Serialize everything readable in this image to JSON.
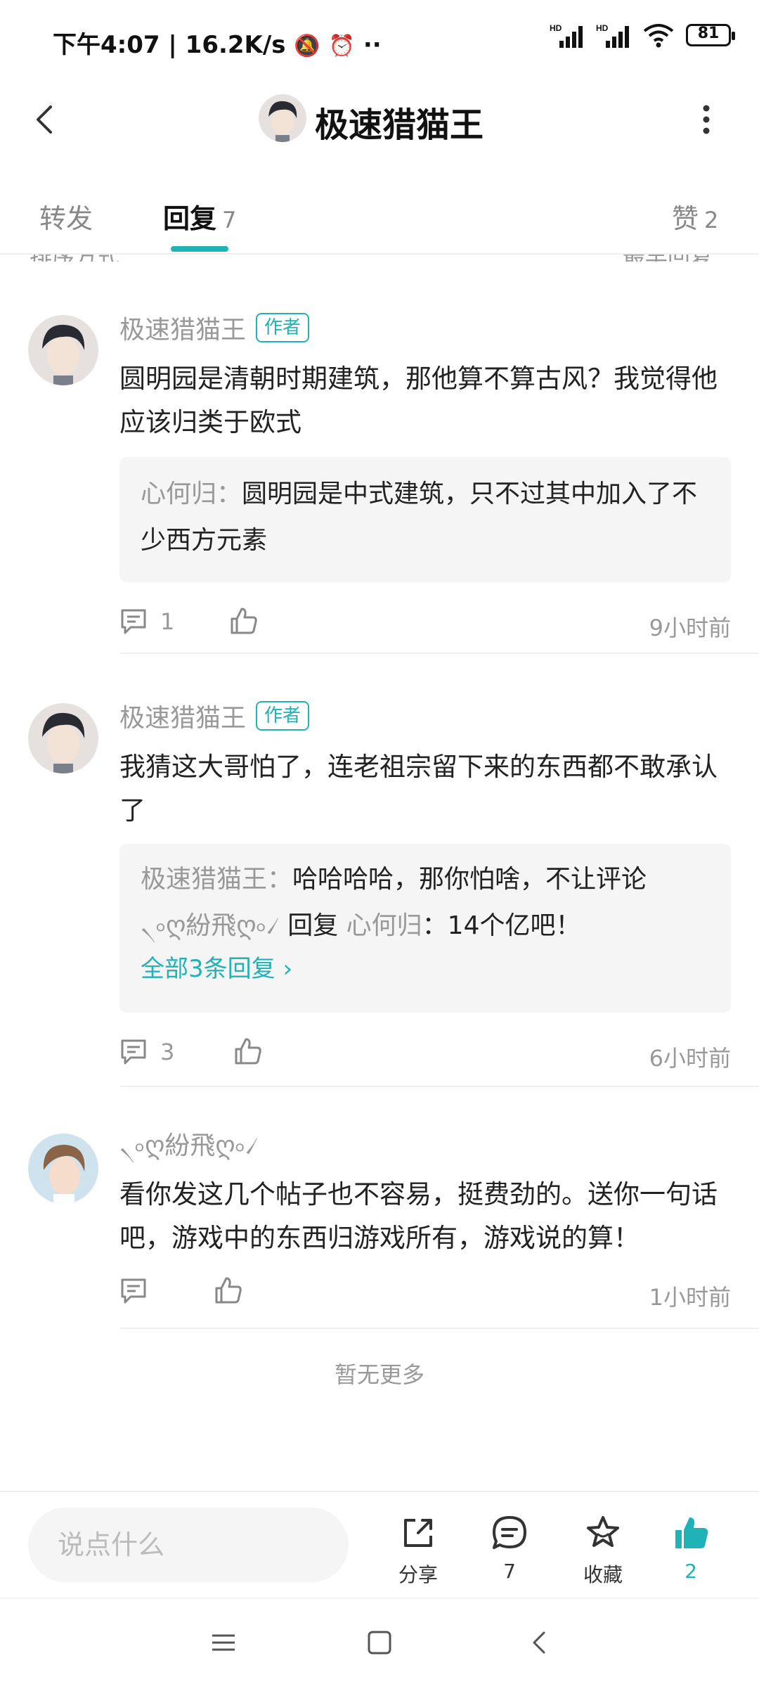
{
  "status_bar": {
    "time_net": "下午4:07 | 16.2K/s",
    "battery": "81"
  },
  "header": {
    "title": "极速猎猫王"
  },
  "tabs": [
    {
      "label": "转发",
      "count": ""
    },
    {
      "label": "回复",
      "count": "7"
    },
    {
      "label": "赞",
      "count": "2"
    }
  ],
  "sort": {
    "left": "排序方式",
    "right": "最早回复 ˅"
  },
  "comments": [
    {
      "author": "极速猎猫王",
      "badge": "作者",
      "text": "圆明园是清朝时期建筑，那他算不算古风？我觉得他应该归类于欧式",
      "reply": {
        "name": "心何归",
        "sep": "：",
        "text": "圆明园是中式建筑，只不过其中加入了不少西方元素"
      },
      "comment_count": "1",
      "time": "9小时前"
    },
    {
      "author": "极速猎猫王",
      "badge": "作者",
      "text": "我猜这大哥怕了，连老祖宗留下来的东西都不敢承认了",
      "reply1": {
        "name": "极速猎猫王",
        "sep": "：",
        "text": "哈哈哈哈，那你怕啥，不让评论"
      },
      "reply2": {
        "name": "৲৹ღ紛飛ღ৹৴",
        "mid": " 回复 ",
        "target": "心何归",
        "sep": "：",
        "text": "14个亿吧！"
      },
      "all_replies": "全部3条回复 ›",
      "comment_count": "3",
      "time": "6小时前"
    },
    {
      "author": "৲৹ღ紛飛ღ৹৴",
      "text": "看你发这几个帖子也不容易，挺费劲的。送你一句话吧，游戏中的东西归游戏所有，游戏说的算！",
      "comment_count": "",
      "time": "1小时前"
    }
  ],
  "no_more": "暂无更多",
  "bottom_bar": {
    "input_placeholder": "说点什么",
    "share": "分享",
    "comments": "7",
    "favorite": "收藏",
    "likes": "2"
  },
  "colors": {
    "accent": "#1fb3b8",
    "muted": "#999999"
  }
}
